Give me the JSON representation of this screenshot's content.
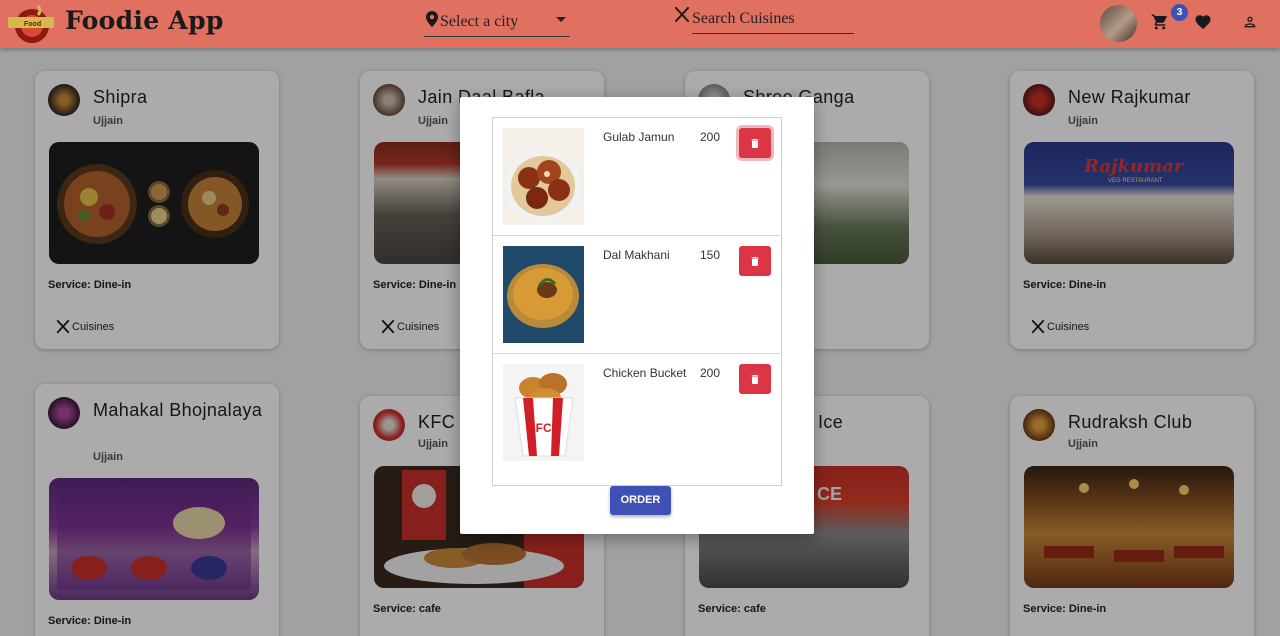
{
  "header": {
    "brand": "Foodie App",
    "logo_text": "Food",
    "city_placeholder": "Select a city",
    "search_placeholder": "Search Cuisines",
    "cart_count": "3",
    "colors": {
      "bar": "#e0705f",
      "badge": "#3f51b5"
    }
  },
  "restaurants": [
    {
      "name": "Shipra",
      "city": "Ujjain",
      "service": "Service: Dine-in",
      "cuisines": "Cuisines"
    },
    {
      "name": "Jain Daal Bafla",
      "city": "Ujjain",
      "service": "Service: Dine-in",
      "cuisines": "Cuisines"
    },
    {
      "name": "Shree Ganga",
      "city": "",
      "service": "",
      "cuisines": ""
    },
    {
      "name": "New Rajkumar",
      "city": "Ujjain",
      "service": "Service: Dine-in",
      "cuisines": "Cuisines"
    },
    {
      "name": "Mahakal Bhojnalaya",
      "city": "Ujjain",
      "service": "Service: Dine-in",
      "cuisines": ""
    },
    {
      "name": "KFC",
      "city": "Ujjain",
      "service": "Service: cafe",
      "cuisines": ""
    },
    {
      "name": "Ice",
      "city": "",
      "service": "Service: cafe",
      "cuisines": ""
    },
    {
      "name": "Rudraksh Club",
      "city": "Ujjain",
      "service": "Service: Dine-in",
      "cuisines": ""
    }
  ],
  "cart_modal": {
    "items": [
      {
        "name": "Gulab Jamun",
        "price": "200",
        "icon": "trash-icon"
      },
      {
        "name": "Dal Makhani",
        "price": "150",
        "icon": "trash-icon"
      },
      {
        "name": "Chicken Bucket",
        "price": "200",
        "icon": "trash-icon"
      }
    ],
    "order_label": "ORDER",
    "colors": {
      "delete": "#dc3545",
      "order": "#3f51b5"
    }
  }
}
